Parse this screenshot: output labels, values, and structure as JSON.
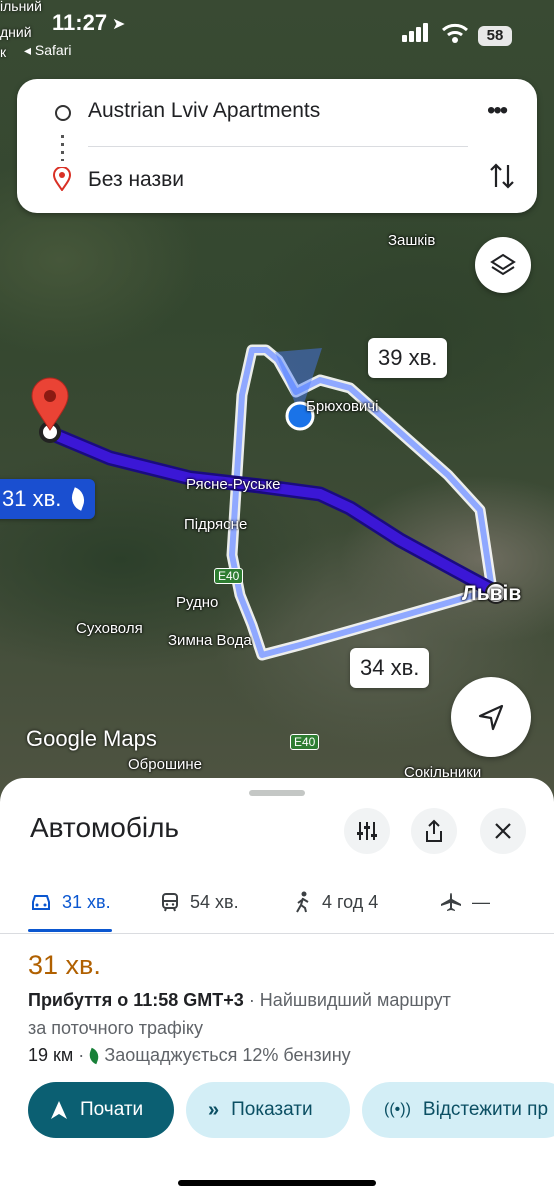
{
  "status_bar": {
    "time": "11:27",
    "back_app": "Safari",
    "battery": "58",
    "bg_lines": [
      "ільний",
      "дний",
      "к"
    ]
  },
  "search": {
    "origin": "Austrian Lviv Apartments",
    "destination": "Без назви"
  },
  "map": {
    "labels": {
      "zashkiv": "Зашків",
      "briukhovychi": "Брюховичі",
      "riasne": "Рясне-Руське",
      "pidriasne": "Підрясне",
      "e40a": "E40",
      "rudno": "Рудно",
      "sukhovolia": "Суховоля",
      "zymna_voda": "Зимна Вода",
      "lviv": "Львів",
      "e40b": "E40",
      "obroshyne": "Оброшине",
      "sokilnyky": "Сокільники"
    },
    "route_times": {
      "alt1": "39 хв.",
      "alt2": "34 хв.",
      "main": "31 хв."
    },
    "google_maps": "Google Maps"
  },
  "sheet": {
    "title": "Автомобіль",
    "tabs": [
      {
        "mode": "car-icon",
        "label": "31 хв."
      },
      {
        "mode": "transit-icon",
        "label": "54 хв."
      },
      {
        "mode": "walk-icon",
        "label": "4 год 4"
      },
      {
        "mode": "flight-icon",
        "label": "—"
      }
    ],
    "duration": "31 хв.",
    "arrival_bold": "Прибуття о 11:58 GMT+3",
    "arrival_rest": " · Найшвидший маршрут",
    "arrival_line2": "за поточного трафіку",
    "distance": "19 км",
    "savings": "Заощаджується 12% бензину",
    "buttons": {
      "start": "Почати",
      "show": "Показати",
      "track": "Відстежити пр"
    }
  },
  "colors": {
    "route_main": "#3b17d6",
    "route_alt": "#8fa8ff",
    "accent": "#0b57d0",
    "duration": "#b06000",
    "primary_btn": "#0b5f72"
  }
}
